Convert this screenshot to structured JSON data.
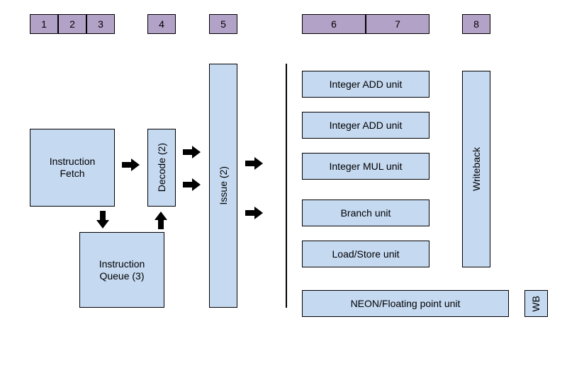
{
  "stages": {
    "s1": "1",
    "s2": "2",
    "s3": "3",
    "s4": "4",
    "s5": "5",
    "s6": "6",
    "s7": "7",
    "s8": "8"
  },
  "blocks": {
    "instruction_fetch": "Instruction\nFetch",
    "instruction_queue": "Instruction\nQueue (3)",
    "decode": "Decode (2)",
    "issue": "Issue (2)",
    "integer_add_unit_1": "Integer ADD unit",
    "integer_add_unit_2": "Integer ADD unit",
    "integer_mul_unit": "Integer MUL unit",
    "branch_unit": "Branch unit",
    "load_store_unit": "Load/Store unit",
    "writeback": "Writeback",
    "neon_fp_unit": "NEON/Floating point unit",
    "wb": "WB"
  }
}
